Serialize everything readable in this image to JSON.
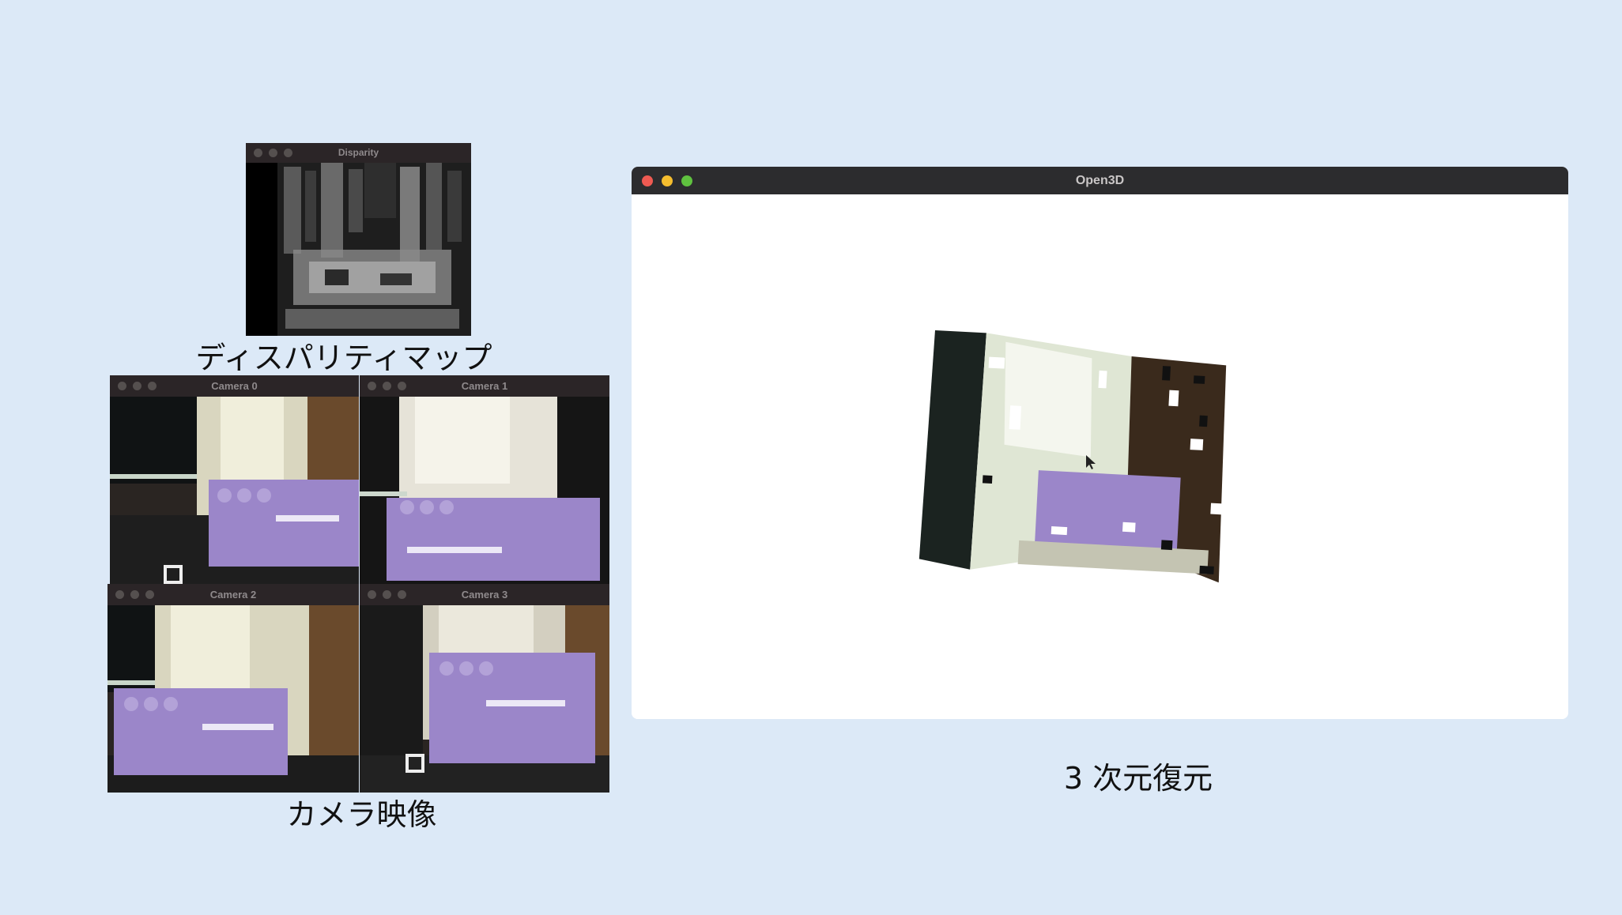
{
  "disparity_window": {
    "title": "Disparity"
  },
  "disparity_caption": "ディスパリティマップ",
  "camera_windows": [
    {
      "title": "Camera 0"
    },
    {
      "title": "Camera 1"
    },
    {
      "title": "Camera 2"
    },
    {
      "title": "Camera 3"
    }
  ],
  "camera_caption": "カメラ映像",
  "open3d_window": {
    "title": "Open3D"
  },
  "reconstruction_caption": "3 次元復元",
  "colors": {
    "background": "#dce9f7",
    "close": "#ee5a52",
    "minimize": "#f5bd2e",
    "zoom": "#5fc13f",
    "box_purple": "#9b86c9"
  }
}
